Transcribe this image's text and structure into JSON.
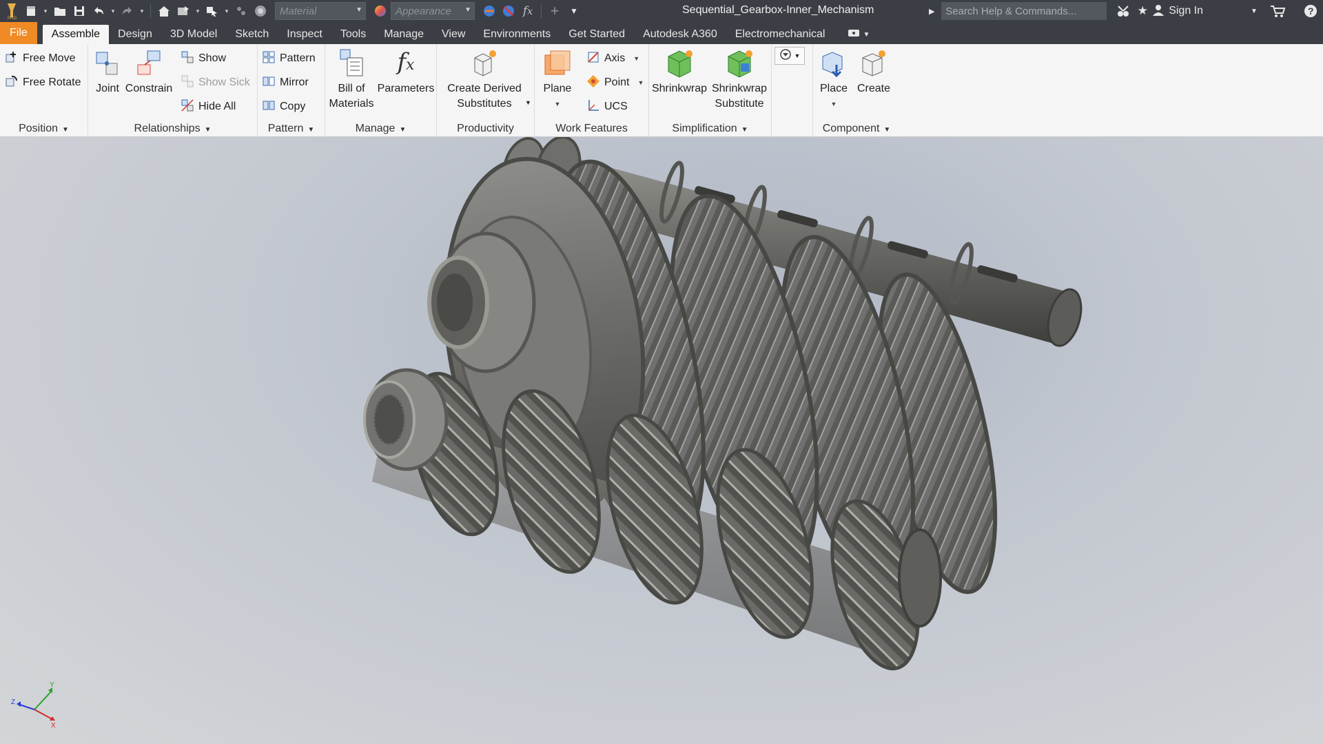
{
  "title_bar": {
    "document_title": "Sequential_Gearbox-Inner_Mechanism",
    "material_placeholder": "Material",
    "appearance_placeholder": "Appearance",
    "search_placeholder": "Search Help & Commands...",
    "sign_in_label": "Sign In"
  },
  "tabs": [
    {
      "label": "File"
    },
    {
      "label": "Assemble"
    },
    {
      "label": "Design"
    },
    {
      "label": "3D Model"
    },
    {
      "label": "Sketch"
    },
    {
      "label": "Inspect"
    },
    {
      "label": "Tools"
    },
    {
      "label": "Manage"
    },
    {
      "label": "View"
    },
    {
      "label": "Environments"
    },
    {
      "label": "Get Started"
    },
    {
      "label": "Autodesk A360"
    },
    {
      "label": "Electromechanical"
    }
  ],
  "ribbon": {
    "position": {
      "label": "Position",
      "free_move": "Free Move",
      "free_rotate": "Free Rotate"
    },
    "relationships": {
      "label": "Relationships",
      "joint": "Joint",
      "constrain": "Constrain",
      "show": "Show",
      "show_sick": "Show Sick",
      "hide_all": "Hide All"
    },
    "pattern": {
      "label": "Pattern",
      "pattern": "Pattern",
      "mirror": "Mirror",
      "copy": "Copy"
    },
    "manage": {
      "label": "Manage",
      "bom_line1": "Bill of",
      "bom_line2": "Materials",
      "parameters": "Parameters"
    },
    "productivity": {
      "label": "Productivity",
      "derived_line1": "Create Derived",
      "derived_line2": "Substitutes"
    },
    "work_features": {
      "label": "Work Features",
      "plane": "Plane",
      "axis": "Axis",
      "point": "Point",
      "ucs": "UCS"
    },
    "simplification": {
      "label": "Simplification",
      "shrinkwrap": "Shrinkwrap",
      "shrinkwrap_sub_line1": "Shrinkwrap",
      "shrinkwrap_sub_line2": "Substitute"
    },
    "component": {
      "label": "Component",
      "place": "Place",
      "create": "Create"
    }
  },
  "colors": {
    "file_tab": "#f08a24",
    "titlebar": "#3b3f45",
    "ribbon": "#f5f5f5",
    "gear_metal": "#6f6f6b"
  }
}
